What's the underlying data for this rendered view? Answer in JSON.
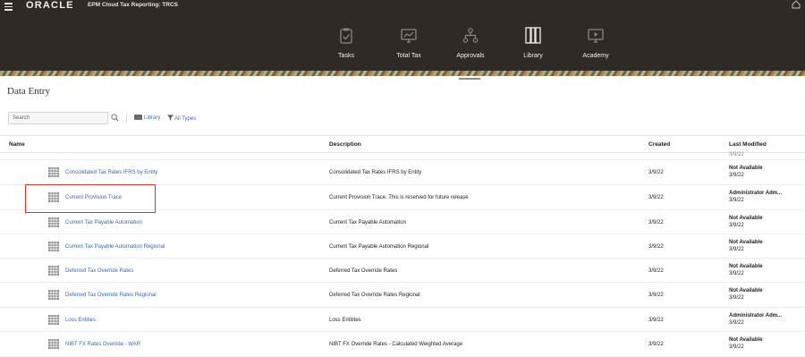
{
  "header": {
    "logo": "ORACLE",
    "app_title": "EPM Cloud Tax Reporting: TRCS",
    "menu_icon": "hamburger-menu-icon",
    "home_icon": "home-icon"
  },
  "nav": [
    {
      "label": "Tasks",
      "icon": "clipboard-icon"
    },
    {
      "label": "Total Tax",
      "icon": "monitor-chart-icon"
    },
    {
      "label": "Approvals",
      "icon": "hierarchy-icon"
    },
    {
      "label": "Library",
      "icon": "books-icon"
    },
    {
      "label": "Academy",
      "icon": "video-play-icon"
    }
  ],
  "page": {
    "title": "Data Entry"
  },
  "toolbar": {
    "search_placeholder": "Search",
    "library_link": "Library",
    "filter_link": "All Types"
  },
  "table": {
    "columns": [
      "Name",
      "Description",
      "Created",
      "Last Modified"
    ],
    "partial_top": {
      "created": "",
      "modified": "3/9/22"
    },
    "rows": [
      {
        "name": "Consolidated Tax Rates IFRS by Entity",
        "description": "Consolidated Tax Rates IFRS by Entity",
        "created": "3/9/22",
        "modified_by": "Not Available",
        "modified_date": "3/9/22"
      },
      {
        "name": "Current Provision Trace",
        "description": "Current Provision Trace. This is reserved for future release",
        "created": "3/9/22",
        "modified_by": "Administrator Adm...",
        "modified_date": "3/9/22"
      },
      {
        "name": "Current Tax Payable Automation",
        "description": "Current Tax Payable Automation",
        "created": "3/9/22",
        "modified_by": "Not Available",
        "modified_date": "3/9/22"
      },
      {
        "name": "Current Tax Payable Automation Regional",
        "description": "Current Tax Payable Automation Regional",
        "created": "3/9/22",
        "modified_by": "Not Available",
        "modified_date": "3/9/22"
      },
      {
        "name": "Deferred Tax Override Rates",
        "description": "Deferred Tax Override Rates",
        "created": "3/9/22",
        "modified_by": "Not Available",
        "modified_date": "3/9/22"
      },
      {
        "name": "Deferred Tax Override Rates Regional",
        "description": "Deferred Tax Override Rates Regional",
        "created": "3/9/22",
        "modified_by": "Not Available",
        "modified_date": "3/9/22"
      },
      {
        "name": "Loss Entities",
        "description": "Loss Entitites",
        "created": "3/9/22",
        "modified_by": "Administrator Adm...",
        "modified_date": "3/9/22"
      },
      {
        "name": "NIBT FX Rates Override - WAR",
        "description": "NIBT FX Override Rates - Calculated Weighted Average",
        "created": "3/9/22",
        "modified_by": "Not Available",
        "modified_date": "3/9/22"
      }
    ]
  },
  "colors": {
    "header_bg": "#302a26",
    "link": "#3a6aa8",
    "highlight": "#d9322c"
  }
}
